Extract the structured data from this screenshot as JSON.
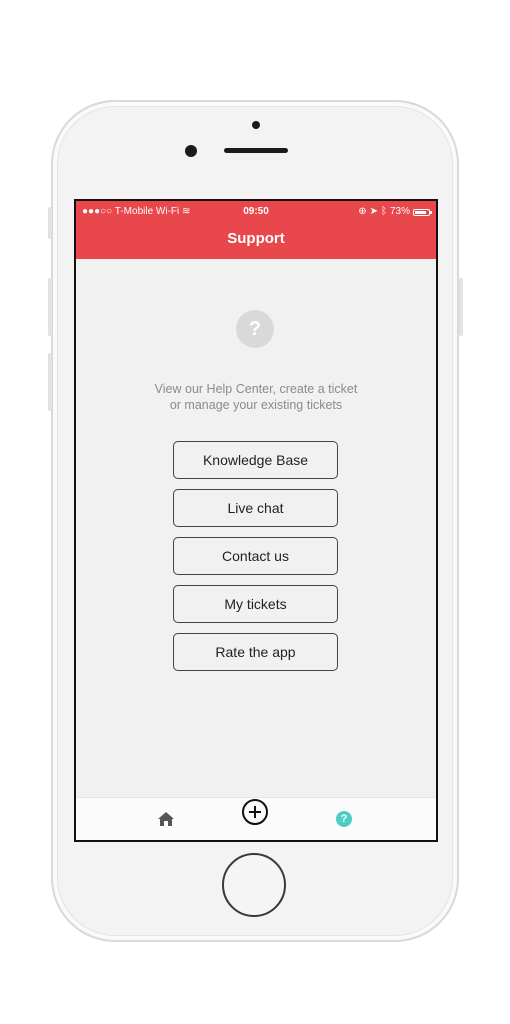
{
  "status_bar": {
    "carrier": "●●●○○ T-Mobile Wi-Fi ≋",
    "time": "09:50",
    "battery": "73%"
  },
  "header": {
    "title": "Support",
    "background": "#e8474b"
  },
  "help_icon": "?",
  "intro": {
    "line1": "View our Help Center, create a ticket",
    "line2": "or manage your existing tickets"
  },
  "buttons": [
    {
      "label": "Knowledge Base"
    },
    {
      "label": "Live chat"
    },
    {
      "label": "Contact us"
    },
    {
      "label": "My tickets"
    },
    {
      "label": "Rate the app"
    }
  ],
  "tabbar": {
    "items": [
      {
        "icon": "home-icon"
      },
      {
        "icon": "add-circle-icon"
      },
      {
        "icon": "help-icon",
        "glyph": "?",
        "color": "#4ecdc4"
      }
    ]
  }
}
